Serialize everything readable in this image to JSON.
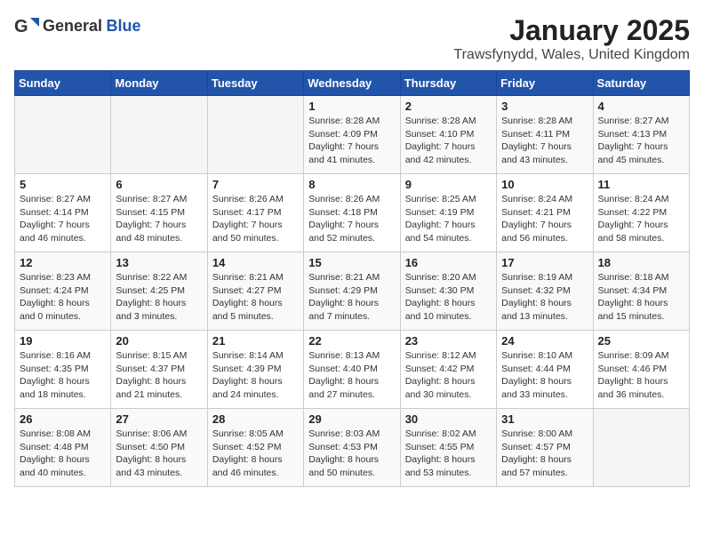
{
  "header": {
    "logo_general": "General",
    "logo_blue": "Blue",
    "month_title": "January 2025",
    "location": "Trawsfynydd, Wales, United Kingdom"
  },
  "weekdays": [
    "Sunday",
    "Monday",
    "Tuesday",
    "Wednesday",
    "Thursday",
    "Friday",
    "Saturday"
  ],
  "weeks": [
    [
      {
        "day": "",
        "content": ""
      },
      {
        "day": "",
        "content": ""
      },
      {
        "day": "",
        "content": ""
      },
      {
        "day": "1",
        "content": "Sunrise: 8:28 AM\nSunset: 4:09 PM\nDaylight: 7 hours\nand 41 minutes."
      },
      {
        "day": "2",
        "content": "Sunrise: 8:28 AM\nSunset: 4:10 PM\nDaylight: 7 hours\nand 42 minutes."
      },
      {
        "day": "3",
        "content": "Sunrise: 8:28 AM\nSunset: 4:11 PM\nDaylight: 7 hours\nand 43 minutes."
      },
      {
        "day": "4",
        "content": "Sunrise: 8:27 AM\nSunset: 4:13 PM\nDaylight: 7 hours\nand 45 minutes."
      }
    ],
    [
      {
        "day": "5",
        "content": "Sunrise: 8:27 AM\nSunset: 4:14 PM\nDaylight: 7 hours\nand 46 minutes."
      },
      {
        "day": "6",
        "content": "Sunrise: 8:27 AM\nSunset: 4:15 PM\nDaylight: 7 hours\nand 48 minutes."
      },
      {
        "day": "7",
        "content": "Sunrise: 8:26 AM\nSunset: 4:17 PM\nDaylight: 7 hours\nand 50 minutes."
      },
      {
        "day": "8",
        "content": "Sunrise: 8:26 AM\nSunset: 4:18 PM\nDaylight: 7 hours\nand 52 minutes."
      },
      {
        "day": "9",
        "content": "Sunrise: 8:25 AM\nSunset: 4:19 PM\nDaylight: 7 hours\nand 54 minutes."
      },
      {
        "day": "10",
        "content": "Sunrise: 8:24 AM\nSunset: 4:21 PM\nDaylight: 7 hours\nand 56 minutes."
      },
      {
        "day": "11",
        "content": "Sunrise: 8:24 AM\nSunset: 4:22 PM\nDaylight: 7 hours\nand 58 minutes."
      }
    ],
    [
      {
        "day": "12",
        "content": "Sunrise: 8:23 AM\nSunset: 4:24 PM\nDaylight: 8 hours\nand 0 minutes."
      },
      {
        "day": "13",
        "content": "Sunrise: 8:22 AM\nSunset: 4:25 PM\nDaylight: 8 hours\nand 3 minutes."
      },
      {
        "day": "14",
        "content": "Sunrise: 8:21 AM\nSunset: 4:27 PM\nDaylight: 8 hours\nand 5 minutes."
      },
      {
        "day": "15",
        "content": "Sunrise: 8:21 AM\nSunset: 4:29 PM\nDaylight: 8 hours\nand 7 minutes."
      },
      {
        "day": "16",
        "content": "Sunrise: 8:20 AM\nSunset: 4:30 PM\nDaylight: 8 hours\nand 10 minutes."
      },
      {
        "day": "17",
        "content": "Sunrise: 8:19 AM\nSunset: 4:32 PM\nDaylight: 8 hours\nand 13 minutes."
      },
      {
        "day": "18",
        "content": "Sunrise: 8:18 AM\nSunset: 4:34 PM\nDaylight: 8 hours\nand 15 minutes."
      }
    ],
    [
      {
        "day": "19",
        "content": "Sunrise: 8:16 AM\nSunset: 4:35 PM\nDaylight: 8 hours\nand 18 minutes."
      },
      {
        "day": "20",
        "content": "Sunrise: 8:15 AM\nSunset: 4:37 PM\nDaylight: 8 hours\nand 21 minutes."
      },
      {
        "day": "21",
        "content": "Sunrise: 8:14 AM\nSunset: 4:39 PM\nDaylight: 8 hours\nand 24 minutes."
      },
      {
        "day": "22",
        "content": "Sunrise: 8:13 AM\nSunset: 4:40 PM\nDaylight: 8 hours\nand 27 minutes."
      },
      {
        "day": "23",
        "content": "Sunrise: 8:12 AM\nSunset: 4:42 PM\nDaylight: 8 hours\nand 30 minutes."
      },
      {
        "day": "24",
        "content": "Sunrise: 8:10 AM\nSunset: 4:44 PM\nDaylight: 8 hours\nand 33 minutes."
      },
      {
        "day": "25",
        "content": "Sunrise: 8:09 AM\nSunset: 4:46 PM\nDaylight: 8 hours\nand 36 minutes."
      }
    ],
    [
      {
        "day": "26",
        "content": "Sunrise: 8:08 AM\nSunset: 4:48 PM\nDaylight: 8 hours\nand 40 minutes."
      },
      {
        "day": "27",
        "content": "Sunrise: 8:06 AM\nSunset: 4:50 PM\nDaylight: 8 hours\nand 43 minutes."
      },
      {
        "day": "28",
        "content": "Sunrise: 8:05 AM\nSunset: 4:52 PM\nDaylight: 8 hours\nand 46 minutes."
      },
      {
        "day": "29",
        "content": "Sunrise: 8:03 AM\nSunset: 4:53 PM\nDaylight: 8 hours\nand 50 minutes."
      },
      {
        "day": "30",
        "content": "Sunrise: 8:02 AM\nSunset: 4:55 PM\nDaylight: 8 hours\nand 53 minutes."
      },
      {
        "day": "31",
        "content": "Sunrise: 8:00 AM\nSunset: 4:57 PM\nDaylight: 8 hours\nand 57 minutes."
      },
      {
        "day": "",
        "content": ""
      }
    ]
  ]
}
